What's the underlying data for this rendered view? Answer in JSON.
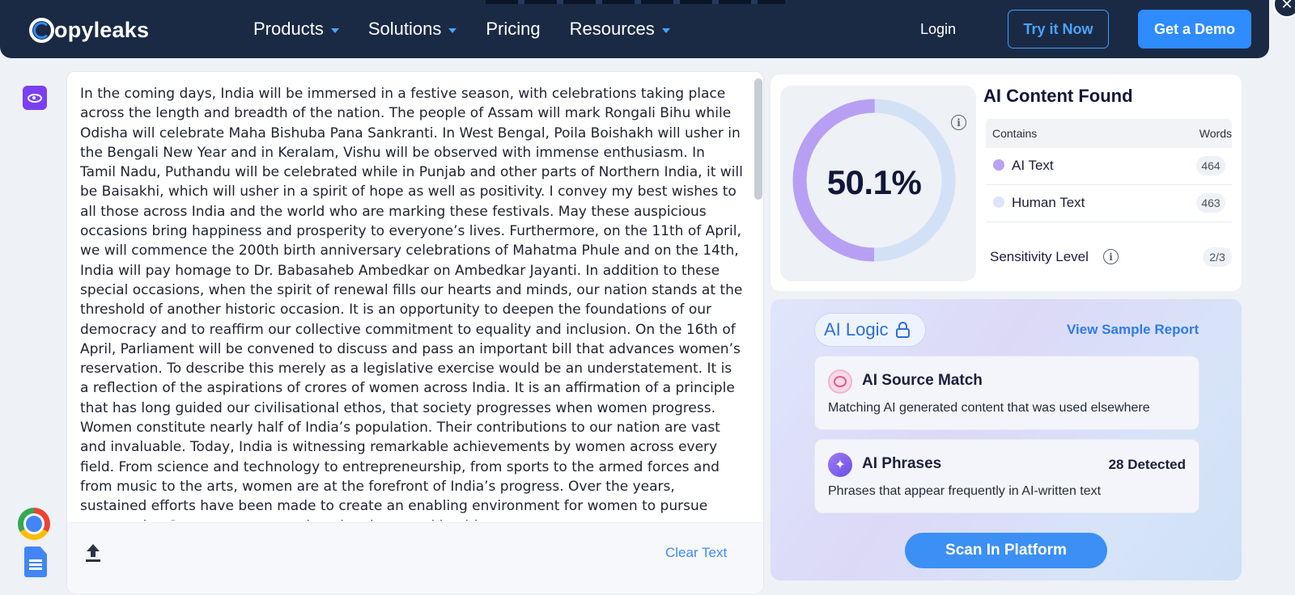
{
  "nav": {
    "logo": "Copyleaks",
    "logo_rest": "opyleaks",
    "menu": [
      {
        "label": "Products"
      },
      {
        "label": "Solutions"
      },
      {
        "label": "Pricing"
      },
      {
        "label": "Resources"
      }
    ],
    "login": "Login",
    "try_label": "Try it Now",
    "demo_label": "Get a Demo"
  },
  "editor": {
    "text": "In the coming days, India will be immersed in a festive season, with celebrations taking place across the length and breadth of the nation. The people of Assam will mark Rongali Bihu while Odisha will celebrate Maha Bishuba Pana Sankranti. In West Bengal, Poila Boishakh will usher in the Bengali New Year and in Keralam, Vishu will be observed with immense enthusiasm. In Tamil Nadu, Puthandu will be celebrated while in Punjab and other parts of Northern India, it will be Baisakhi, which will usher in a spirit of hope as well as positivity. I convey my best wishes to all those across India and the world who are marking these festivals. May these auspicious occasions bring happiness and prosperity to everyone’s lives. Furthermore, on the 11th of April, we will commence the 200th birth anniversary celebrations of Mahatma Phule and on the 14th, India will pay homage to Dr. Babasaheb Ambedkar on Ambedkar Jayanti. In addition to these special occasions, when the spirit of renewal fills our hearts and minds, our nation stands at the threshold of another historic occasion. It is an opportunity to deepen the foundations of our democracy and to reaffirm our collective commitment to equality and inclusion. On the 16th of April, Parliament will be convened to discuss and pass an important bill that advances women’s reservation. To describe this merely as a legislative exercise would be an understatement. It is a reflection of the aspirations of crores of women across India. It is an affirmation of a principle that has long guided our civilisational ethos, that society progresses when women progress. Women constitute nearly half of India’s population. Their contributions to our nation are vast and invaluable. Today, India is witnessing remarkable achievements by women across every field. From science and technology to entrepreneurship, from sports to the armed forces and from music to the arts, women are at the forefront of India’s progress. Over the years, sustained efforts have been made to create an enabling environment for women to pursue opportunity. Greater access to education, improved health",
    "clear_label": "Clear Text"
  },
  "result": {
    "percent": "50.1%",
    "ai_fraction": 0.501,
    "title": "AI Content Found",
    "col_contains": "Contains",
    "col_words": "Words",
    "rows": [
      {
        "label": "AI Text",
        "count": "464",
        "color": "#b9a3f3"
      },
      {
        "label": "Human Text",
        "count": "463",
        "color": "#dbe6f8"
      }
    ],
    "sensitivity_label": "Sensitivity Level",
    "sensitivity_value": "2/3",
    "colors": {
      "ai_arc": "#b7a0f4",
      "human_arc": "#d3e1f7"
    }
  },
  "logic": {
    "pill_label": "AI Logic",
    "view_sample": "View Sample Report",
    "source_match": {
      "title": "AI Source Match",
      "desc": "Matching AI generated content that was used elsewhere"
    },
    "phrases": {
      "title": "AI Phrases",
      "detected": "28 Detected",
      "desc": "Phrases that appear frequently in AI-written text"
    },
    "scan_label": "Scan In Platform"
  }
}
